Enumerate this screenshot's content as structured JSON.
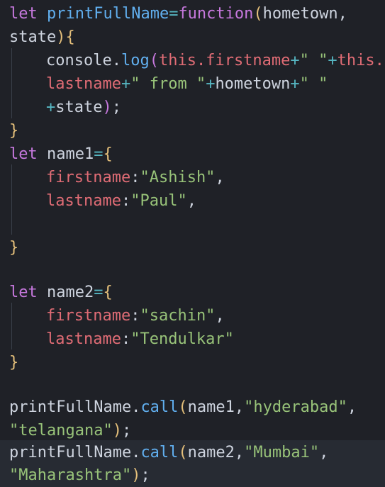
{
  "code": {
    "l01": {
      "t1": "let",
      "t2": "printFullName",
      "t3": "=",
      "t4": "function",
      "t5": "(",
      "t6": "hometown,"
    },
    "l02": {
      "t1": "state",
      "t2": ")",
      "t3": "{"
    },
    "l03": {
      "t1": "console.",
      "t2": "log",
      "t3": "(",
      "t4": "this.",
      "t5": "firstname",
      "t6": "+",
      "t7": "\" \"",
      "t8": "+",
      "t9": "this."
    },
    "l04": {
      "t1": "lastname",
      "t2": "+",
      "t3": "\" from \"",
      "t4": "+",
      "t5": "hometown",
      "t6": "+",
      "t7": "\" \""
    },
    "l05": {
      "t1": "+",
      "t2": "state",
      "t3": ")",
      "t4": ";"
    },
    "l06": {
      "t1": "}"
    },
    "l07": {
      "t1": "let",
      "t2": "name1",
      "t3": "=",
      "t4": "{"
    },
    "l08": {
      "t1": "firstname",
      "t2": ":",
      "t3": "\"Ashish\"",
      "t4": ","
    },
    "l09": {
      "t1": "lastname",
      "t2": ":",
      "t3": "\"Paul\"",
      "t4": ","
    },
    "l11": {
      "t1": "}"
    },
    "l13": {
      "t1": "let",
      "t2": "name2",
      "t3": "=",
      "t4": "{"
    },
    "l14": {
      "t1": "firstname",
      "t2": ":",
      "t3": "\"sachin\"",
      "t4": ","
    },
    "l15": {
      "t1": "lastname",
      "t2": ":",
      "t3": "\"Tendulkar\""
    },
    "l16": {
      "t1": "}"
    },
    "l18": {
      "t1": "printFullName.",
      "t2": "call",
      "t3": "(",
      "t4": "name1,",
      "t5": "\"hyderabad\"",
      "t6": ","
    },
    "l19": {
      "t1": "\"telangana\"",
      "t2": ")",
      "t3": ";"
    },
    "l20": {
      "t1": "printFullName.",
      "t2": "call",
      "t3": "(",
      "t4": "name2,",
      "t5": "\"Mumbai\"",
      "t6": ","
    },
    "l21": {
      "t1": "\"Maharashtra\"",
      "t2": ")",
      "t3": ";"
    }
  },
  "colors": {
    "background": "#1f2127",
    "keyword": "#c678dd",
    "function": "#61afef",
    "property": "#e06c75",
    "string": "#98c379",
    "operator": "#56b6c2",
    "bracket": "#e5c07b",
    "text": "#cdd3de"
  }
}
